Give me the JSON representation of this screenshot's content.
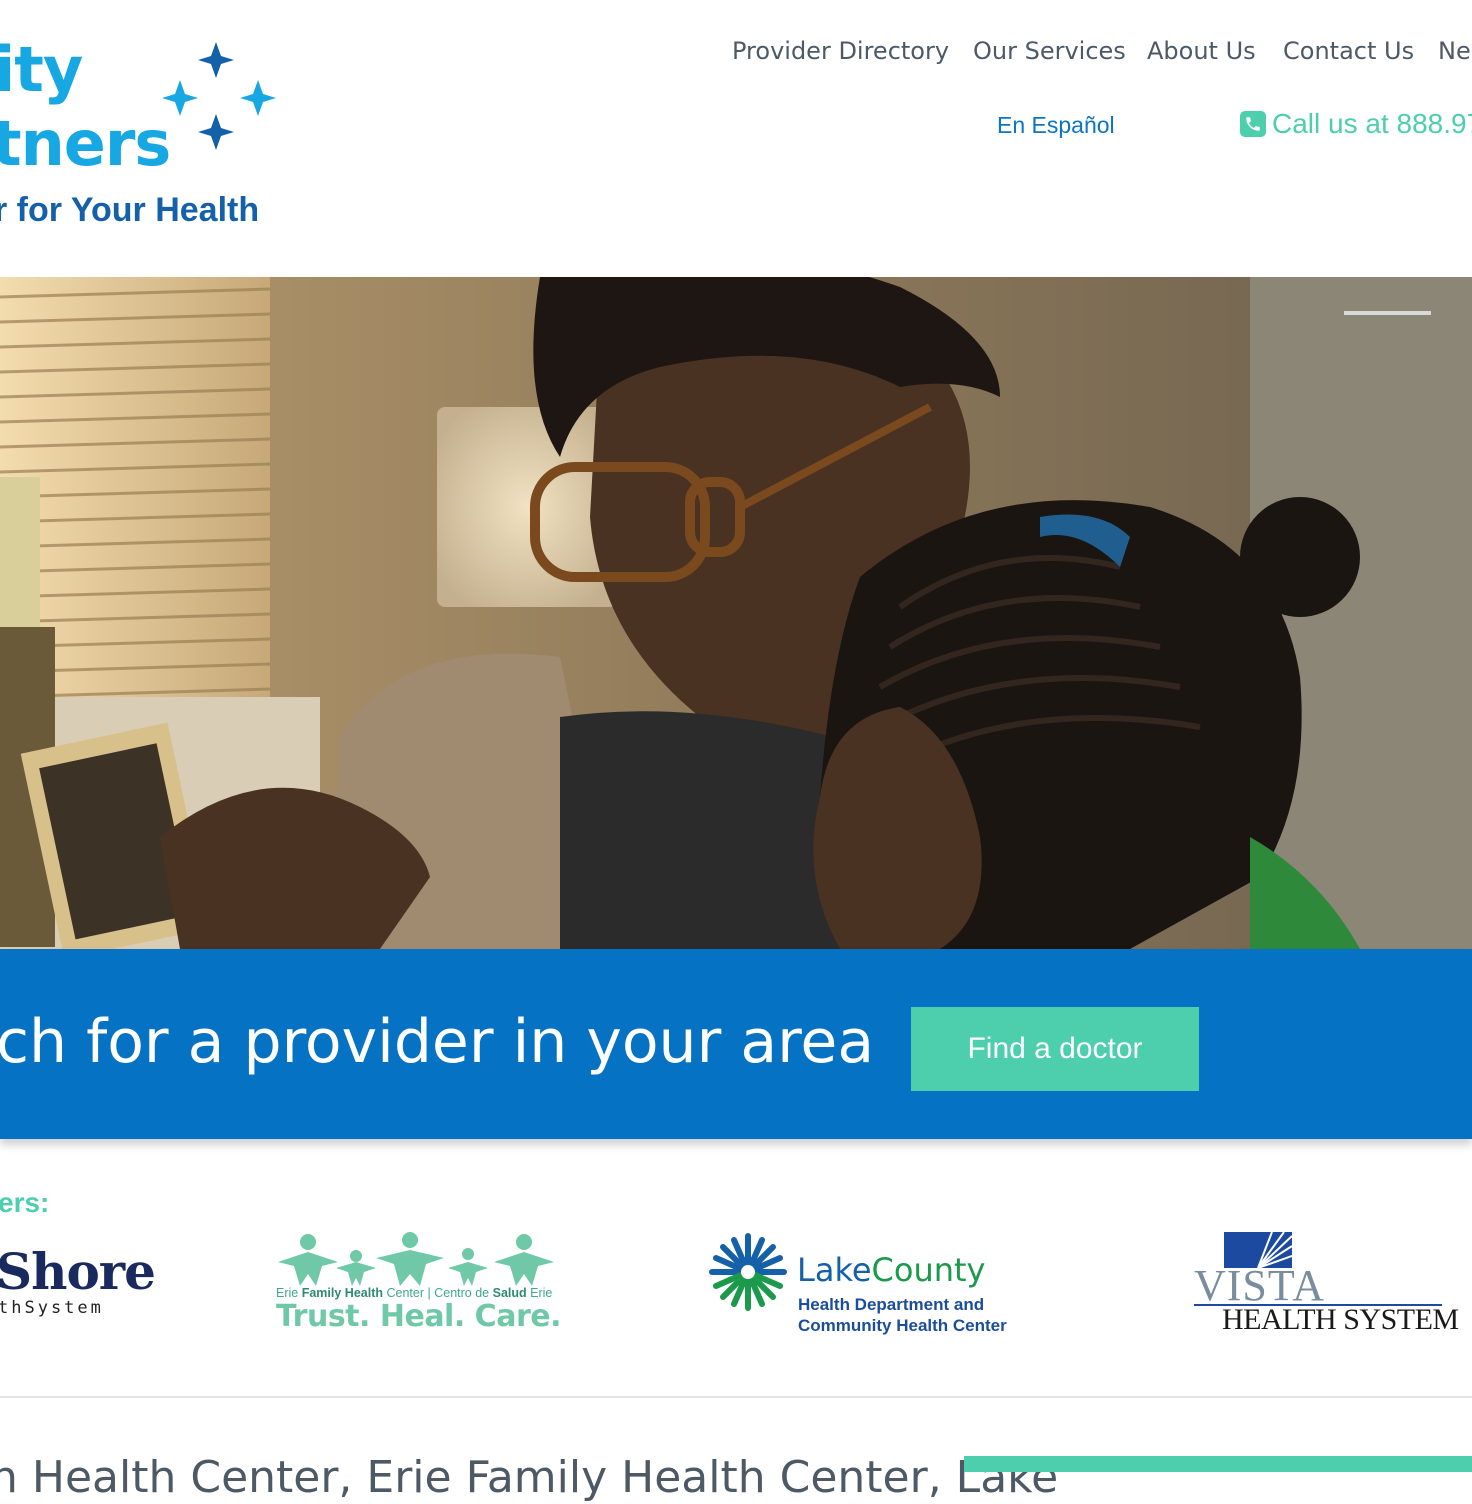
{
  "header": {
    "logo_line1": "ity",
    "logo_line2": "tners",
    "logo_tagline": "r for Your Health"
  },
  "nav": {
    "items": [
      {
        "label": "Provider Directory"
      },
      {
        "label": "Our Services"
      },
      {
        "label": "About Us"
      },
      {
        "label": "Contact Us"
      },
      {
        "label": "Ne"
      }
    ],
    "language_link": "En Español",
    "call_text": "Call us at 888.97"
  },
  "hero": {
    "search_text": "ch for a provider in your area",
    "find_button": "Find a doctor"
  },
  "partners": {
    "label": "ers:",
    "northshore": {
      "name": "Shore",
      "sub": "thSystem"
    },
    "erie": {
      "top_left": "Erie",
      "top_bold": "Family Health",
      "top_mid": "Center",
      "top_right_pre": "Centro de",
      "top_right_bold": "Salud",
      "top_right_post": "Erie",
      "motto": "Trust. Heal. Care."
    },
    "lake": {
      "name_part1": "Lake",
      "name_part2": "County",
      "sub1": "Health Department and",
      "sub2": "Community Health Center"
    },
    "vista": {
      "word": "VISTA",
      "sub": "HEALTH SYSTEM"
    }
  },
  "bottom": {
    "partial_text": "h Health Center, Erie Family Health Center, Lake"
  },
  "colors": {
    "brand_blue": "#0672c4",
    "teal": "#4dcfae",
    "logo_light_blue": "#17a8e3",
    "logo_dark_blue": "#1561a9",
    "nav_text": "#4d5a66"
  },
  "icons": [
    "star-sparkle-icon",
    "phone-icon",
    "sunburst-logo-icon",
    "sunrise-logo-icon"
  ]
}
